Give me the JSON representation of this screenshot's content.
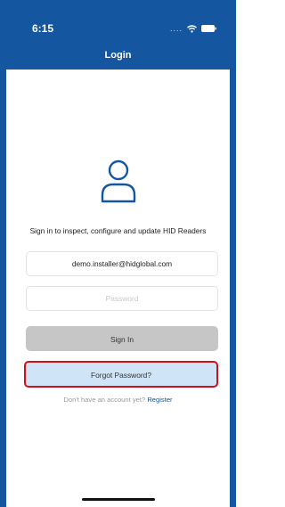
{
  "status_bar": {
    "time": "6:15",
    "signal_dots": "....",
    "icons": [
      "wifi-icon",
      "battery-icon"
    ]
  },
  "header": {
    "title": "Login"
  },
  "main": {
    "avatar_icon": "user-icon",
    "tagline": "Sign in to inspect, configure and update HID Readers",
    "email_value": "demo.installer@hidglobal.com",
    "password_placeholder": "Password",
    "signin_label": "Sign In",
    "forgot_label": "Forgot Password?",
    "register_prompt": "Don't have an account yet?",
    "register_link": "Register"
  },
  "colors": {
    "brand": "#1456a0",
    "highlight_border": "#d0101a",
    "forgot_fill": "#cfe4f7",
    "disabled_button": "#c6c6c6"
  }
}
